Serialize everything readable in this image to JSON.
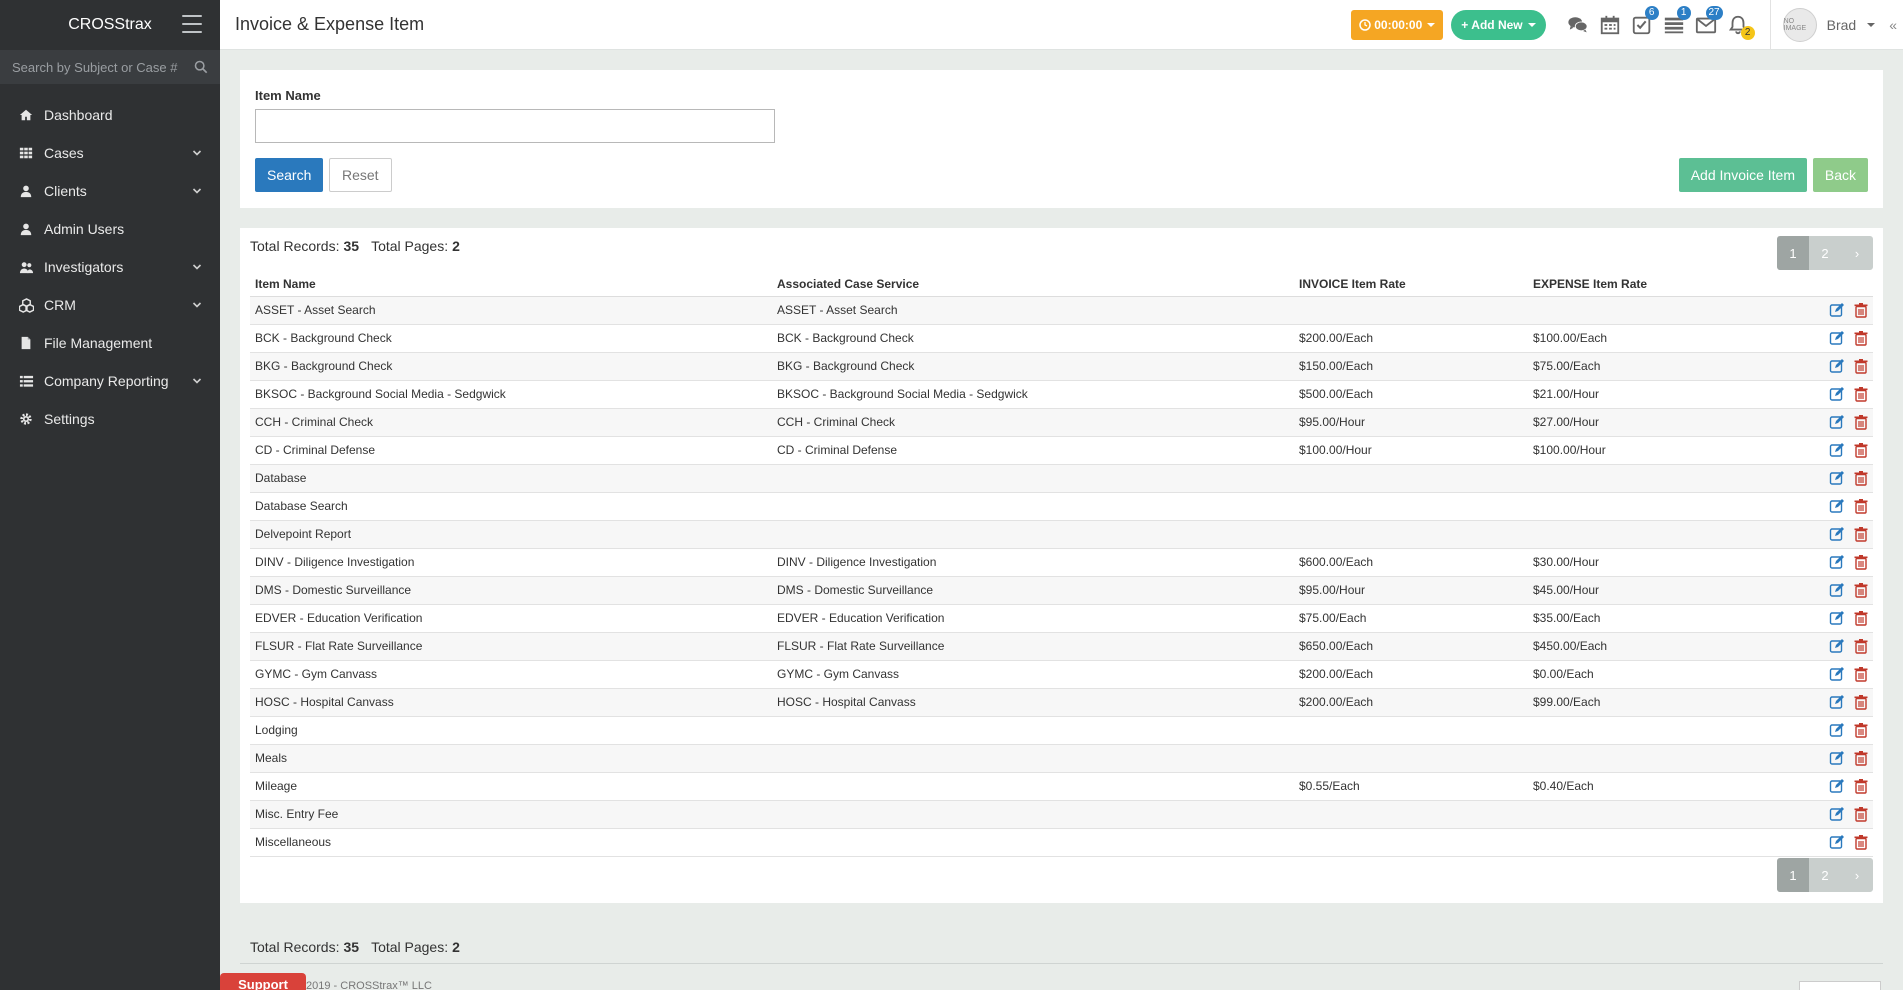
{
  "app": {
    "brand": "CROSStrax"
  },
  "sidebar": {
    "search_placeholder": "Search by Subject or Case #",
    "items": [
      {
        "label": "Dashboard",
        "icon": "home-icon",
        "has_children": false
      },
      {
        "label": "Cases",
        "icon": "grid-icon",
        "has_children": true
      },
      {
        "label": "Clients",
        "icon": "user-icon",
        "has_children": true
      },
      {
        "label": "Admin Users",
        "icon": "user-icon",
        "has_children": false
      },
      {
        "label": "Investigators",
        "icon": "users-icon",
        "has_children": true
      },
      {
        "label": "CRM",
        "icon": "cubes-icon",
        "has_children": true
      },
      {
        "label": "File Management",
        "icon": "file-icon",
        "has_children": false
      },
      {
        "label": "Company Reporting",
        "icon": "list-icon",
        "has_children": true
      },
      {
        "label": "Settings",
        "icon": "gear-icon",
        "has_children": false
      }
    ]
  },
  "header": {
    "title": "Invoice & Expense Item",
    "timer": "00:00:00",
    "add_new": "Add New",
    "badges": {
      "tasks": "6",
      "list": "1",
      "mail": "27",
      "alerts": "2"
    },
    "user_name": "Brad",
    "avatar_text": "NO IMAGE",
    "collapse_icon": "«",
    "colors": {
      "timer": "#f5a623",
      "add_new": "#3cbf8d",
      "badge": "#2c7fc6"
    }
  },
  "search_form": {
    "item_name_label": "Item Name",
    "item_name_value": "",
    "search_label": "Search",
    "reset_label": "Reset",
    "add_invoice_label": "Add Invoice Item",
    "back_label": "Back"
  },
  "records": {
    "total_records_label": "Total Records:",
    "total_records": "35",
    "total_pages_label": "Total Pages:",
    "total_pages": "2"
  },
  "pagination": {
    "pages": [
      "1",
      "2"
    ],
    "current": "1",
    "next": "›"
  },
  "table": {
    "headers": [
      "Item Name",
      "Associated Case Service",
      "INVOICE Item Rate",
      "EXPENSE Item Rate"
    ],
    "rows": [
      [
        "ASSET - Asset Search",
        "ASSET - Asset Search",
        "",
        ""
      ],
      [
        "BCK - Background Check",
        "BCK - Background Check",
        "$200.00/Each",
        "$100.00/Each"
      ],
      [
        "BKG - Background Check",
        "BKG - Background Check",
        "$150.00/Each",
        "$75.00/Each"
      ],
      [
        "BKSOC - Background Social Media - Sedgwick",
        "BKSOC - Background Social Media - Sedgwick",
        "$500.00/Each",
        "$21.00/Hour"
      ],
      [
        "CCH - Criminal Check",
        "CCH - Criminal Check",
        "$95.00/Hour",
        "$27.00/Hour"
      ],
      [
        "CD - Criminal Defense",
        "CD - Criminal Defense",
        "$100.00/Hour",
        "$100.00/Hour"
      ],
      [
        "Database",
        "",
        "",
        ""
      ],
      [
        "Database Search",
        "",
        "",
        ""
      ],
      [
        "Delvepoint Report",
        "",
        "",
        ""
      ],
      [
        "DINV - Diligence Investigation",
        "DINV - Diligence Investigation",
        "$600.00/Each",
        "$30.00/Hour"
      ],
      [
        "DMS - Domestic Surveillance",
        "DMS - Domestic Surveillance",
        "$95.00/Hour",
        "$45.00/Hour"
      ],
      [
        "EDVER - Education Verification",
        "EDVER - Education Verification",
        "$75.00/Each",
        "$35.00/Each"
      ],
      [
        "FLSUR - Flat Rate Surveillance",
        "FLSUR - Flat Rate Surveillance",
        "$650.00/Each",
        "$450.00/Each"
      ],
      [
        "GYMC - Gym Canvass",
        "GYMC - Gym Canvass",
        "$200.00/Each",
        "$0.00/Each"
      ],
      [
        "HOSC - Hospital Canvass",
        "HOSC - Hospital Canvass",
        "$200.00/Each",
        "$99.00/Each"
      ],
      [
        "Lodging",
        "",
        "",
        ""
      ],
      [
        "Meals",
        "",
        "",
        ""
      ],
      [
        "Mileage",
        "",
        "$0.55/Each",
        "$0.40/Each"
      ],
      [
        "Misc. Entry Fee",
        "",
        "",
        ""
      ],
      [
        "Miscellaneous",
        "",
        "",
        ""
      ]
    ],
    "row_action_icons": [
      "edit-icon",
      "trash-icon"
    ]
  },
  "footer": {
    "support_label": "Support",
    "copyright": "2019 - CROSStrax™ LLC"
  }
}
